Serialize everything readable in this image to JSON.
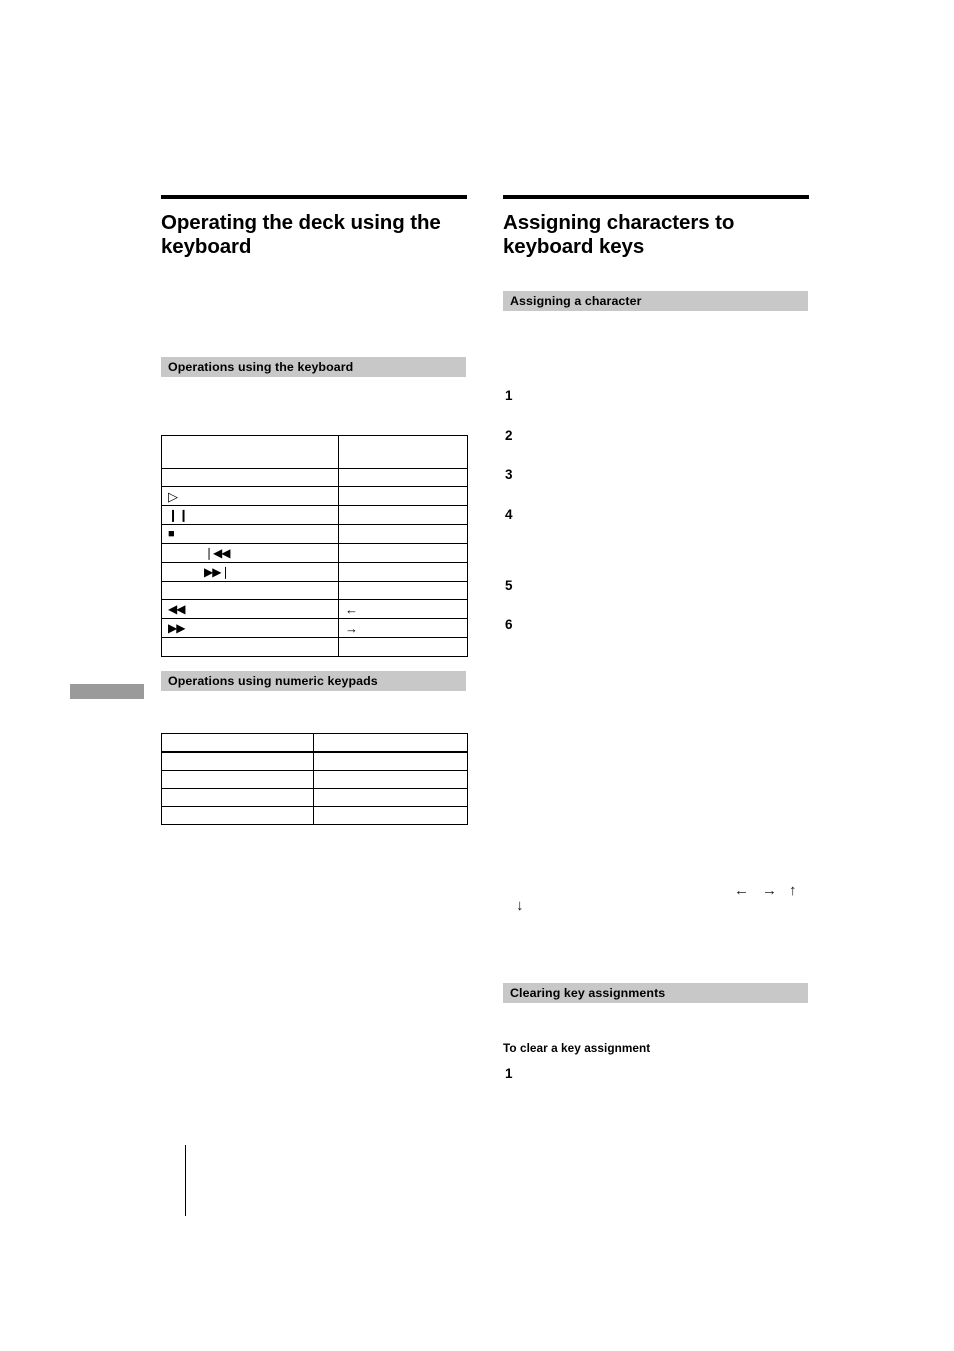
{
  "page": {
    "background": "#ffffff",
    "bar_color": "#c8c8c8",
    "tab_color": "#9a9a9a",
    "rule_color": "#000000"
  },
  "left_column": {
    "section_title": "Operating the deck using the keyboard",
    "bar_headings": [
      {
        "label": "Operations using the keyboard"
      },
      {
        "label": "Operations using numeric keypads"
      }
    ],
    "keyboard_table": {
      "rows": [
        {
          "left": "",
          "right": "",
          "indent": false,
          "thick": false
        },
        {
          "left": "",
          "right": "",
          "indent": false,
          "thick": false
        },
        {
          "left": "▷",
          "right": "",
          "indent": false,
          "thick": false,
          "icon": "play-icon"
        },
        {
          "left": "❙❙",
          "right": "",
          "indent": false,
          "thick": false,
          "icon": "pause-icon"
        },
        {
          "left": "■",
          "right": "",
          "indent": false,
          "thick": false,
          "icon": "stop-icon"
        },
        {
          "left": "❘◀◀",
          "right": "",
          "indent": true,
          "thick": false,
          "icon": "previous-track-icon"
        },
        {
          "left": "▶▶❘",
          "right": "",
          "indent": true,
          "thick": false,
          "icon": "next-track-icon"
        },
        {
          "left": "",
          "right": "",
          "indent": false,
          "thick": false
        },
        {
          "left": "◀◀",
          "right": "←",
          "indent": false,
          "thick": false,
          "icon": "rewind-icon"
        },
        {
          "left": "▶▶",
          "right": "→",
          "indent": false,
          "thick": false,
          "icon": "fast-forward-icon"
        },
        {
          "left": "",
          "right": "",
          "indent": false,
          "thick": false
        }
      ]
    },
    "keypad_table": {
      "rows": [
        {
          "left": "",
          "right": "",
          "thick": true
        },
        {
          "left": "",
          "right": "",
          "thick": false
        },
        {
          "left": "",
          "right": "",
          "thick": false
        },
        {
          "left": "",
          "right": "",
          "thick": false
        },
        {
          "left": "",
          "right": "",
          "thick": false
        }
      ]
    }
  },
  "right_column": {
    "section_title": "Assigning characters to keyboard keys",
    "bar_headings": [
      {
        "label": "Assigning a character"
      },
      {
        "label": "Clearing key assignments"
      }
    ],
    "assign_steps": [
      {
        "number": "1"
      },
      {
        "number": "2"
      },
      {
        "number": "3"
      },
      {
        "number": "4"
      },
      {
        "number": "5"
      },
      {
        "number": "6"
      }
    ],
    "arrow_marks": [
      {
        "glyph": "↓",
        "name": "down-arrow-icon"
      },
      {
        "glyph": "←",
        "name": "left-arrow-icon"
      },
      {
        "glyph": "→",
        "name": "right-arrow-icon"
      },
      {
        "glyph": "↑",
        "name": "up-arrow-icon"
      }
    ],
    "clearing_sub_heading": "To clear a key assignment",
    "clearing_steps": [
      {
        "number": "1"
      }
    ]
  }
}
